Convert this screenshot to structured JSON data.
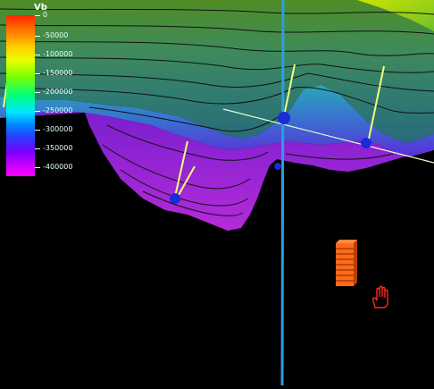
{
  "legend": {
    "title": "Vb",
    "labels": [
      "0",
      "-50000",
      "-100000",
      "-150000",
      "-200000",
      "-250000",
      "-300000",
      "-350000",
      "-400000"
    ]
  },
  "scene": {
    "surface_palette": [
      "#2e7d32",
      "#4caf50",
      "#7bd13a",
      "#2ec4b6",
      "#8a1fd6",
      "#c02aff"
    ],
    "well_color": "#2a9fe0",
    "vector_color": "#f2ff7a",
    "marker_color": "#1a2bd8",
    "scale_bar_color": "#ff6a1a",
    "hand_icon": "hand-cursor-icon"
  }
}
